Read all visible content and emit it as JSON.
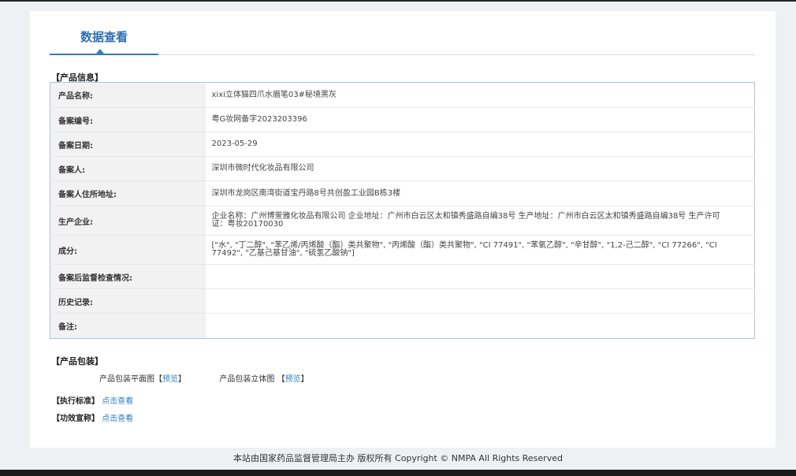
{
  "tab": {
    "label": "数据查看"
  },
  "product_info": {
    "title": "【产品信息】",
    "rows": [
      {
        "label": "产品名称:",
        "value": "xixi立体猫四爪水眉笔03#秘境黑灰"
      },
      {
        "label": "备案编号:",
        "value": "粤G妆网备字2023203396"
      },
      {
        "label": "备案日期:",
        "value": "2023-05-29"
      },
      {
        "label": "备案人:",
        "value": "深圳市微时代化妆品有限公司"
      },
      {
        "label": "备案人住所地址:",
        "value": "深圳市龙岗区南湾街道宝丹路8号共创盈工业园B栋3楼"
      },
      {
        "label": "生产企业:",
        "value": "企业名称：广州博萱雅化妆品有限公司 企业地址：广州市白云区太和镇秀盛路自编38号 生产地址：广州市白云区太和镇秀盛路自编38号 生产许可证：粤妆20170030"
      },
      {
        "label": "成分:",
        "value": "[\"水\", \"丁二醇\", \"苯乙烯/丙烯酸（酯）类共聚物\", \"丙烯酸（酯）类共聚物\", \"CI 77491\", \"苯氧乙醇\", \"辛甘醇\", \"1,2-己二醇\", \"CI 77266\", \"CI 77492\", \"乙基己基甘油\", \"硫氢乙酸钠\"]"
      },
      {
        "label": "备案后监督检查情况:",
        "value": ""
      },
      {
        "label": "历史记录:",
        "value": ""
      },
      {
        "label": "备注:",
        "value": ""
      }
    ]
  },
  "packaging": {
    "title": "【产品包装】",
    "flat_label": "产品包装平面图",
    "stereo_label": "产品包装立体图",
    "bracket_open": "【",
    "bracket_close": "】",
    "preview_link": "预览"
  },
  "standard": {
    "tag": "【执行标准】",
    "link": "点击查看"
  },
  "efficacy": {
    "tag": "【功效宣称】",
    "link": "点击查看"
  },
  "footer": {
    "text": "本站由国家药品监督管理局主办 版权所有 Copyright © NMPA All Rights Reserved"
  },
  "colors": {
    "accent": "#2f7fc1",
    "label_bg": "#f2f2f2",
    "border": "#a9c4e3"
  }
}
